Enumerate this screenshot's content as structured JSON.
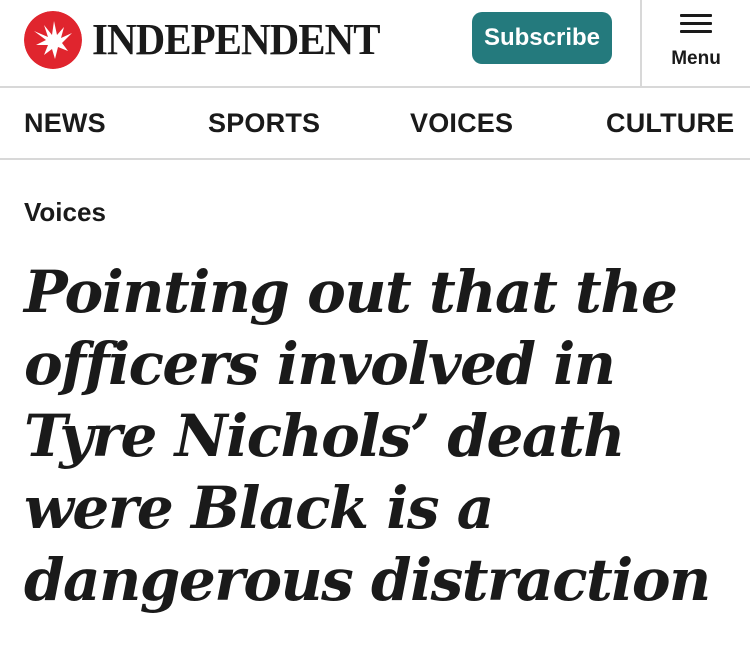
{
  "header": {
    "brand_name": "INDEPENDENT",
    "logo_icon": "eagle-logo-icon",
    "subscribe_label": "Subscribe",
    "menu_label": "Menu",
    "colors": {
      "logo_red": "#e0252e",
      "subscribe_bg": "#247a7d"
    }
  },
  "nav": {
    "items": [
      {
        "label": "NEWS"
      },
      {
        "label": "SPORTS"
      },
      {
        "label": "VOICES"
      },
      {
        "label": "CULTURE"
      }
    ]
  },
  "article": {
    "section": "Voices",
    "headline": "Pointing out that the officers involved in Tyre Nichols’ death were Black is a dangerous distraction"
  }
}
